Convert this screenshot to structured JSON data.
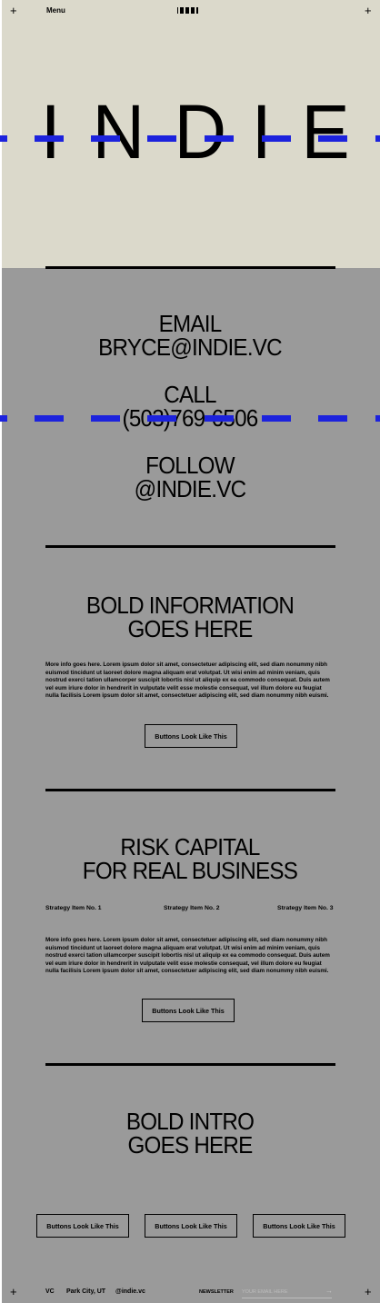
{
  "nav": {
    "menu_label": "Menu",
    "plus_glyph": "+"
  },
  "hero": {
    "letters": [
      "I",
      "N",
      "D",
      "I",
      "E"
    ],
    "background_color": "#dbd9cb"
  },
  "accent_color": "#1c22dd",
  "contact": {
    "email_label": "EMAIL",
    "email_value": "BRYCE@INDIE.VC",
    "call_label": "CALL",
    "call_value": "(503)769-6506",
    "follow_label": "FOLLOW",
    "follow_value": "@INDIE.VC"
  },
  "section_bold_info": {
    "heading_line1": "BOLD INFORMATION",
    "heading_line2": "GOES HERE",
    "body_lines": [
      "More info goes here. Lorem ipsum dolor sit amet, consectetuer adipiscing elit, sed diam nonummy nibh",
      "euismod tincidunt ut laoreet dolore magna aliquam erat volutpat. Ut wisi enim ad minim veniam, quis",
      "nostrud exerci tation ullamcorper suscipit lobortis nisl ut aliquip ex ea commodo consequat. Duis autem",
      "vel eum iriure dolor in hendrerit in vulputate velit esse molestie consequat, vel illum dolore eu feugiat",
      "nulla facilisis Lorem ipsum dolor sit amet, consectetuer adipiscing elit, sed diam nonummy nibh euismi."
    ],
    "button_label": "Buttons Look Like This"
  },
  "section_risk": {
    "heading_line1": "RISK CAPITAL",
    "heading_line2": "FOR REAL BUSINESS",
    "strategy_items": [
      "Strategy Item No. 1",
      "Strategy Item No. 2",
      "Strategy Item No. 3"
    ],
    "body_lines": [
      "More info goes here. Lorem ipsum dolor sit amet, consectetuer adipiscing elit, sed diam nonummy nibh",
      "euismod tincidunt ut laoreet dolore magna aliquam erat volutpat. Ut wisi enim ad minim veniam, quis",
      "nostrud exerci tation ullamcorper suscipit lobortis nisl ut aliquip ex ea commodo consequat. Duis autem",
      "vel eum iriure dolor in hendrerit in vulputate velit esse molestie consequat, vel illum dolore eu feugiat",
      "nulla facilisis Lorem ipsum dolor sit amet, consectetuer adipiscing elit, sed diam nonummy nibh euismi."
    ],
    "button_label": "Buttons Look Like This"
  },
  "section_intro": {
    "heading_line1": "BOLD INTRO",
    "heading_line2": "GOES HERE",
    "buttons": [
      "Buttons Look Like This",
      "Buttons Look Like This",
      "Buttons Look Like This"
    ]
  },
  "footer": {
    "vc": "VC",
    "location": "Park City, UT",
    "handle": "@indie.vc",
    "newsletter_label": "NEWSLETTER",
    "newsletter_placeholder": "YOUR EMAIL HERE",
    "submit_glyph": "→"
  }
}
